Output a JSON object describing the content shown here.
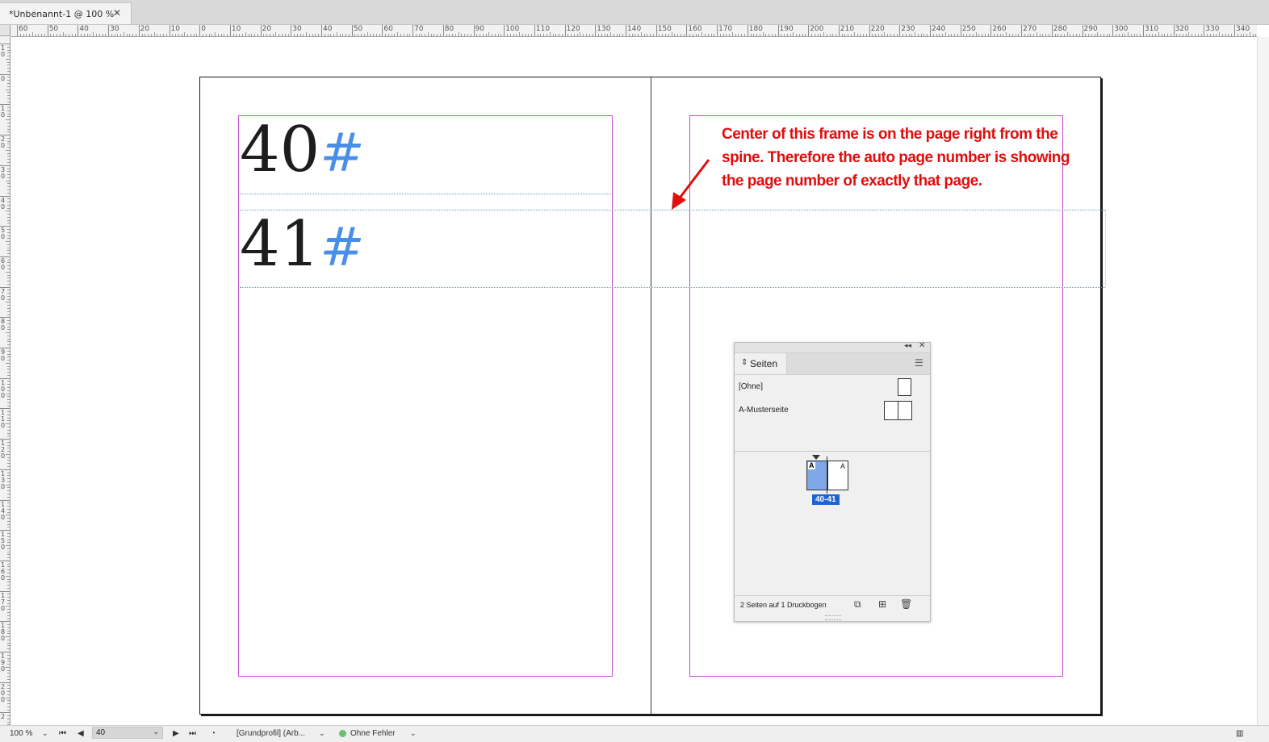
{
  "document_tab": {
    "title": "*Unbenannt-1 @ 100 %",
    "close_glyph": "✕"
  },
  "ruler": {
    "h_labels": [
      "60",
      "50",
      "40",
      "30",
      "20",
      "10",
      "0",
      "10",
      "20",
      "30",
      "40",
      "50",
      "60",
      "70",
      "80",
      "90",
      "100",
      "110",
      "120",
      "130",
      "140",
      "150",
      "160",
      "170",
      "180",
      "190",
      "200",
      "210",
      "220",
      "230",
      "240",
      "250",
      "260",
      "270",
      "280",
      "290",
      "300",
      "310",
      "320",
      "330",
      "340"
    ],
    "v_labels": [
      "1 0",
      "0",
      "1 0",
      "2 0",
      "3 0",
      "4 0",
      "5 0",
      "6 0",
      "7 0",
      "8 0",
      "9 0",
      "1 0 0",
      "1 1 0",
      "1 2 0",
      "1 3 0",
      "1 4 0",
      "1 5 0",
      "1 6 0",
      "1 7 0",
      "1 8 0",
      "1 9 0",
      "2 0 0",
      "2"
    ]
  },
  "spread": {
    "left_page_numbers": [
      {
        "digits": "40",
        "marker": "#"
      },
      {
        "digits": "41",
        "marker": "#"
      }
    ]
  },
  "annotation": {
    "text": "Center of this frame is on the page right from the spine. Therefore the auto page number is showing the page number of exactly that page.",
    "color": "#e00e0e"
  },
  "pages_panel": {
    "tab_label": "Seiten",
    "masters": [
      {
        "label": "[Ohne]"
      },
      {
        "label": "A-Musterseite"
      }
    ],
    "spread": {
      "left_letter": "A",
      "right_letter": "A",
      "label": "40-41",
      "selection_color": "#7ea9e6",
      "label_color": "#1f63d3"
    },
    "footer_text": "2 Seiten auf 1 Druckbogen"
  },
  "status_bar": {
    "zoom": "100 %",
    "page_value": "40",
    "profile": "[Grundprofil] (Arb...",
    "preflight_status": "Ohne Fehler",
    "status_color": "#6fbf73"
  },
  "icons": [
    "close-icon",
    "collapse-icon",
    "panel-menu-icon",
    "page-arrows-icon",
    "new-page-icon",
    "delete-page-icon",
    "page-size-icon",
    "first-page-icon",
    "prev-page-icon",
    "next-page-icon",
    "last-page-icon",
    "dropdown-icon",
    "preflight-icon",
    "view-mode-icon"
  ]
}
